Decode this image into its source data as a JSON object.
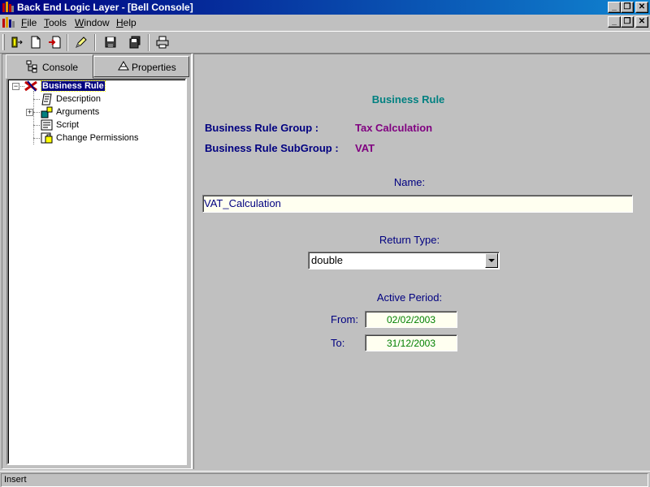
{
  "window": {
    "title": "Back End Logic Layer - [Bell Console]",
    "controls": {
      "minimize": "_",
      "restore": "❐",
      "close": "✕"
    }
  },
  "menu": {
    "items": [
      {
        "label": "File",
        "accel": "F",
        "rest": "ile"
      },
      {
        "label": "Tools",
        "accel": "T",
        "rest": "ools"
      },
      {
        "label": "Window",
        "accel": "W",
        "rest": "indow"
      },
      {
        "label": "Help",
        "accel": "H",
        "rest": "elp"
      }
    ]
  },
  "toolbar": {
    "buttons": [
      "exit-icon",
      "new-document-icon",
      "import-icon",
      "edit-icon",
      "save-icon",
      "save-all-icon",
      "print-icon"
    ]
  },
  "left": {
    "tabs": [
      {
        "label": "Console",
        "icon": "console-tree-icon",
        "active": true
      },
      {
        "label": "Properties",
        "icon": "properties-icon",
        "active": false
      }
    ],
    "tree": {
      "root": {
        "label": "Business Rule",
        "icon": "business-rule-icon",
        "expander": "−"
      },
      "children": [
        {
          "label": "Description",
          "icon": "description-icon"
        },
        {
          "label": "Arguments",
          "icon": "arguments-icon",
          "expander": "+"
        },
        {
          "label": "Script",
          "icon": "script-icon"
        },
        {
          "label": "Change Permissions",
          "icon": "permissions-icon"
        }
      ]
    }
  },
  "form": {
    "heading": "Business Rule",
    "group_label": "Business Rule Group :",
    "group_value": "Tax Calculation",
    "subgroup_label": "Business Rule SubGroup :",
    "subgroup_value": "VAT",
    "name_label": "Name:",
    "name_value": "VAT_Calculation",
    "return_type_label": "Return Type:",
    "return_type_value": "double",
    "active_period_label": "Active Period:",
    "from_label": "From:",
    "from_value": "02/02/2003",
    "to_label": "To:",
    "to_value": "31/12/2003",
    "colors": {
      "heading": "#008080",
      "label": "#000080",
      "value": "#800080",
      "date": "#008000"
    }
  },
  "status": {
    "text": "Insert"
  }
}
